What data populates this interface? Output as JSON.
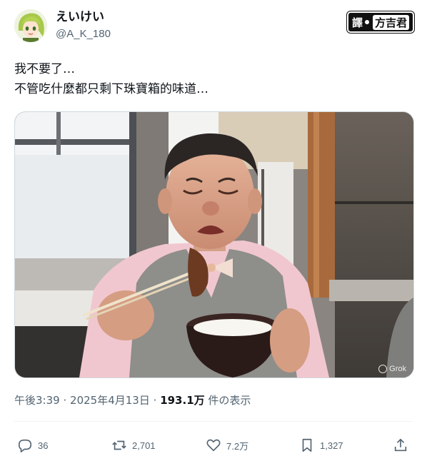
{
  "author": {
    "display_name": "えいけい",
    "handle": "@A_K_180"
  },
  "watermark": {
    "prefix": "譯",
    "brand": "方吉君"
  },
  "post": {
    "lines": [
      "我不要了…",
      "不管吃什麼都只剩下珠寶箱的味道…"
    ]
  },
  "media": {
    "badge": "Grok"
  },
  "meta": {
    "time": "午後3:39",
    "separator": "·",
    "date": "2025年4月13日",
    "views": "193.1万",
    "views_label": "件の表示"
  },
  "actions": {
    "replies": "36",
    "reposts": "2,701",
    "likes": "7.2万",
    "bookmarks": "1,327"
  },
  "colors": {
    "text": "#0f1419",
    "secondary": "#536471",
    "border": "#cfd9de"
  },
  "icons": {
    "reply": "reply-icon",
    "repost": "repost-icon",
    "like": "heart-icon",
    "bookmark": "bookmark-icon",
    "share": "share-icon"
  }
}
